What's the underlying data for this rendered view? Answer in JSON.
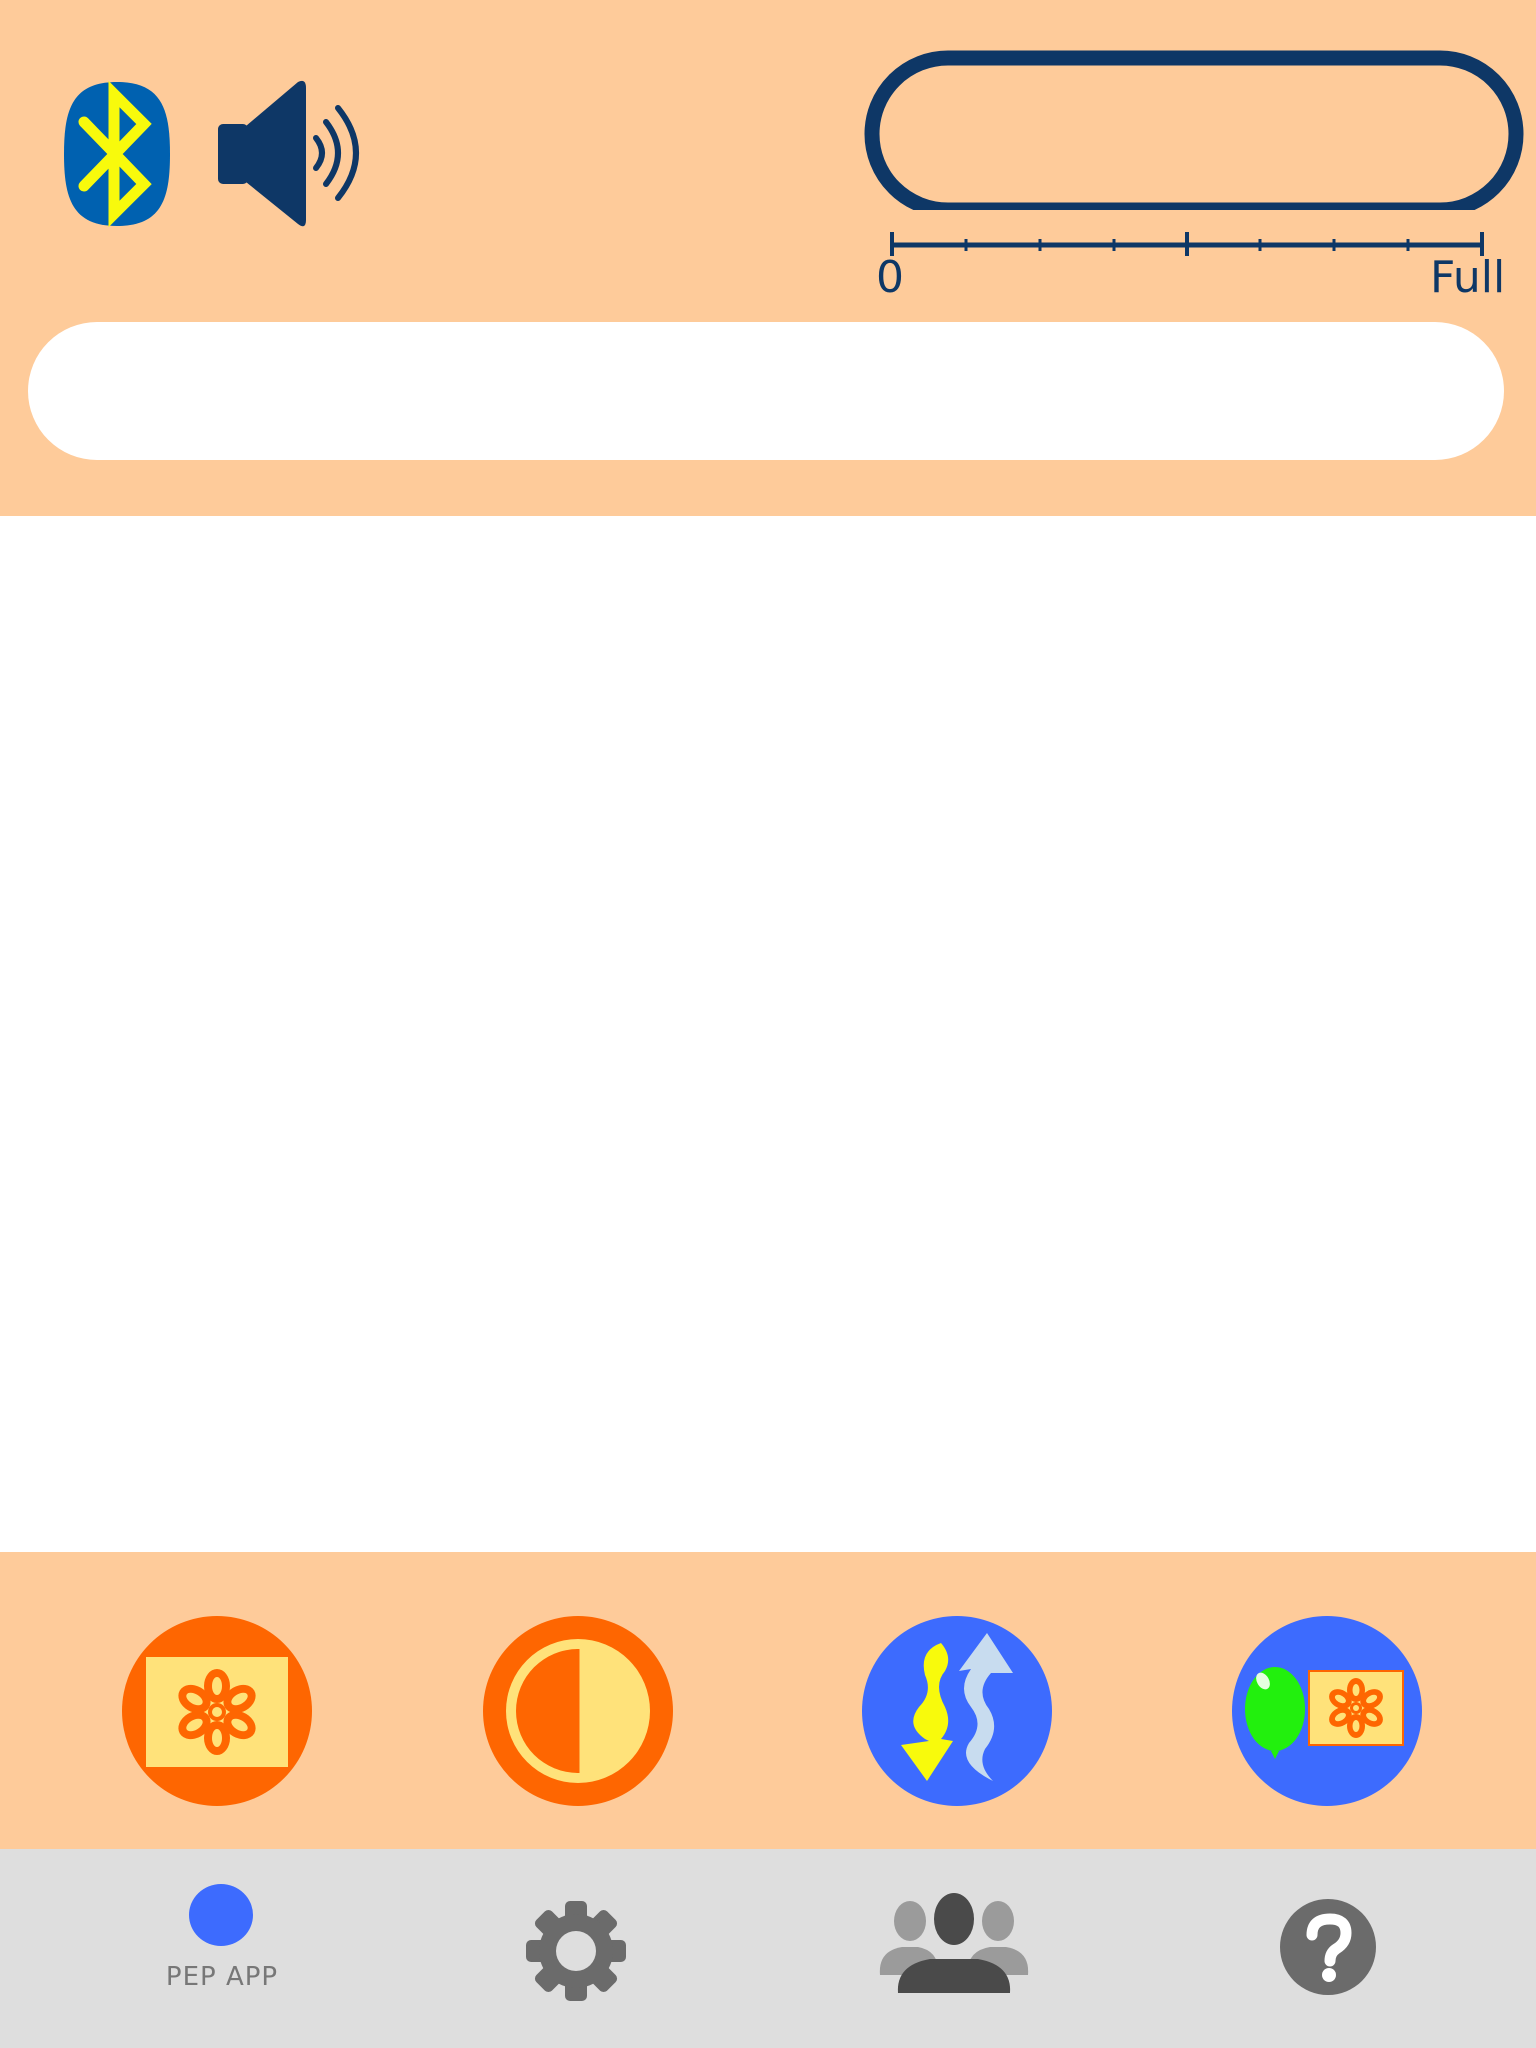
{
  "colors": {
    "header_bg": "#FECB9A",
    "tab_bar_bg": "#DEDEDE",
    "navy": "#0E3766",
    "bluetooth_blue": "#0061B0",
    "bluetooth_yellow": "#F8FA0C",
    "orange": "#FE6601",
    "pale_yellow": "#FFE27A",
    "blue": "#3D6BFE",
    "gray_icon": "#6B6B6B"
  },
  "header": {
    "bluetooth_icon": "bluetooth-icon",
    "speaker_icon": "speaker-volume-icon",
    "level_meter": {
      "value": 0,
      "scale_min_label": "0",
      "scale_max_label": "Full"
    },
    "message_text": ""
  },
  "actions": [
    {
      "icon": "flower-picture-icon"
    },
    {
      "icon": "contrast-icon"
    },
    {
      "icon": "inhale-exhale-arrows-icon"
    },
    {
      "icon": "balloon-flower-icon"
    }
  ],
  "tab_bar": {
    "tabs": [
      {
        "icon": "dot-icon",
        "label": "PEP APP",
        "selected": true
      },
      {
        "icon": "gear-icon",
        "label": ""
      },
      {
        "icon": "users-icon",
        "label": ""
      },
      {
        "icon": "help-icon",
        "label": ""
      }
    ]
  }
}
